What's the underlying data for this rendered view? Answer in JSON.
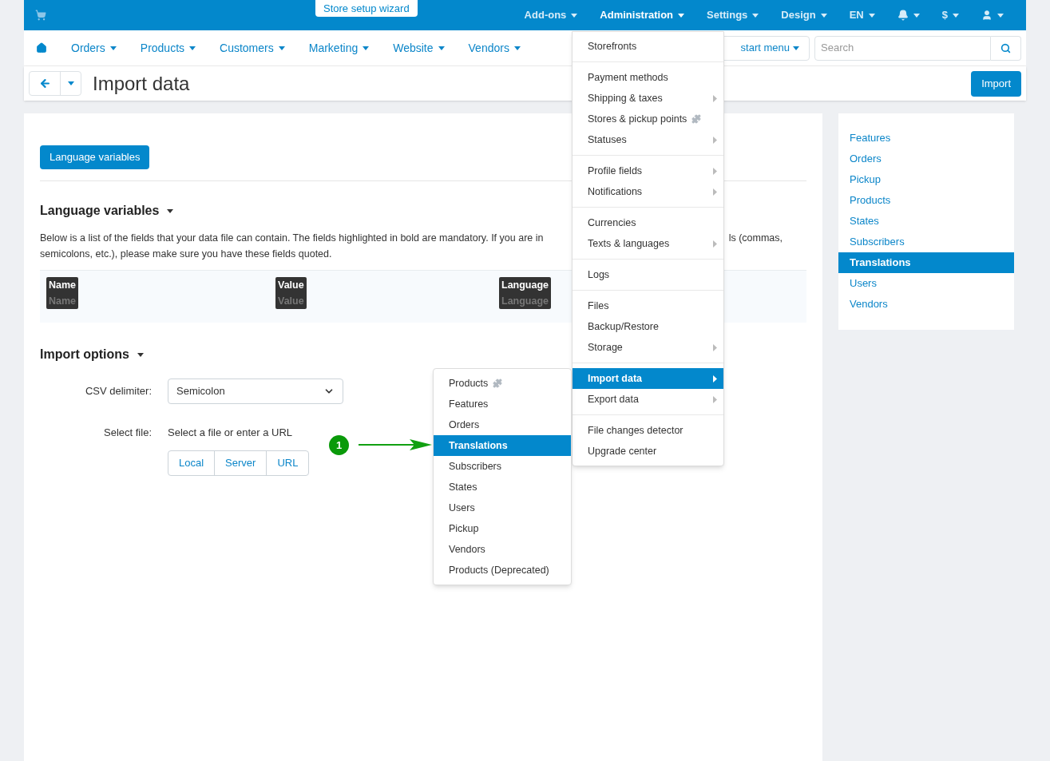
{
  "top_bar": {
    "wizard": "Store setup wizard",
    "items": [
      {
        "kind": "text",
        "label": "Add-ons",
        "selected": false
      },
      {
        "kind": "text",
        "label": "Administration",
        "selected": true
      },
      {
        "kind": "text",
        "label": "Settings",
        "selected": false
      },
      {
        "kind": "text",
        "label": "Design",
        "selected": false
      },
      {
        "kind": "text",
        "label": "EN",
        "selected": false
      },
      {
        "kind": "bell",
        "selected": false
      },
      {
        "kind": "text",
        "label": "$",
        "selected": false
      },
      {
        "kind": "user",
        "selected": false
      }
    ]
  },
  "main_nav": [
    "Orders",
    "Products",
    "Customers",
    "Marketing",
    "Website",
    "Vendors"
  ],
  "quick_menu": "start menu",
  "search": {
    "placeholder": "Search"
  },
  "page_title": "Import data",
  "import_button": "Import",
  "section_tab": "Language variables",
  "fields_section": {
    "title": "Language variables",
    "text_left": "Below is a list of the fields that your data file can contain. The fields highlighted in bold are mandatory. If you are in",
    "text_right": "ls (commas,",
    "text_line2": "semicolons, etc.), please make sure you have these fields quoted.",
    "fields": [
      {
        "label": "Name",
        "sample": "Name",
        "mandatory": true
      },
      {
        "label": "Value",
        "sample": "Value",
        "mandatory": true
      },
      {
        "label": "Language",
        "sample": "Language",
        "mandatory": true
      }
    ]
  },
  "import_options": {
    "title": "Import options",
    "csv_label": "CSV delimiter:",
    "csv_value": "Semicolon",
    "file_label": "Select file:",
    "file_hint": "Select a file or enter a URL",
    "file_buttons": [
      "Local",
      "Server",
      "URL"
    ]
  },
  "annotation": {
    "number": "1"
  },
  "sidebar": [
    {
      "label": "Features",
      "selected": false
    },
    {
      "label": "Orders",
      "selected": false
    },
    {
      "label": "Pickup",
      "selected": false
    },
    {
      "label": "Products",
      "selected": false
    },
    {
      "label": "States",
      "selected": false
    },
    {
      "label": "Subscribers",
      "selected": false
    },
    {
      "label": "Translations",
      "selected": true
    },
    {
      "label": "Users",
      "selected": false
    },
    {
      "label": "Vendors",
      "selected": false
    }
  ],
  "admin_menu": [
    [
      {
        "label": "Storefronts",
        "kind": "link",
        "selected": false
      }
    ],
    [
      {
        "label": "Payment methods",
        "kind": "link",
        "selected": false
      },
      {
        "label": "Shipping & taxes",
        "kind": "submenu",
        "selected": false
      },
      {
        "label": "Stores & pickup points",
        "kind": "addon",
        "selected": false
      },
      {
        "label": "Statuses",
        "kind": "submenu",
        "selected": false
      }
    ],
    [
      {
        "label": "Profile fields",
        "kind": "submenu",
        "selected": false
      },
      {
        "label": "Notifications",
        "kind": "submenu",
        "selected": false
      }
    ],
    [
      {
        "label": "Currencies",
        "kind": "link",
        "selected": false
      },
      {
        "label": "Texts & languages",
        "kind": "submenu",
        "selected": false
      }
    ],
    [
      {
        "label": "Logs",
        "kind": "link",
        "selected": false
      }
    ],
    [
      {
        "label": "Files",
        "kind": "link",
        "selected": false
      },
      {
        "label": "Backup/Restore",
        "kind": "link",
        "selected": false
      },
      {
        "label": "Storage",
        "kind": "submenu",
        "selected": false
      }
    ],
    [
      {
        "label": "Import data",
        "kind": "submenu",
        "selected": true
      },
      {
        "label": "Export data",
        "kind": "submenu",
        "selected": false
      }
    ],
    [
      {
        "label": "File changes detector",
        "kind": "link",
        "selected": false
      },
      {
        "label": "Upgrade center",
        "kind": "link",
        "selected": false
      }
    ]
  ],
  "import_submenu": [
    {
      "label": "Products",
      "kind": "addon",
      "selected": false
    },
    {
      "label": "Features",
      "kind": "link",
      "selected": false
    },
    {
      "label": "Orders",
      "kind": "link",
      "selected": false
    },
    {
      "label": "Translations",
      "kind": "link",
      "selected": true
    },
    {
      "label": "Subscribers",
      "kind": "link",
      "selected": false
    },
    {
      "label": "States",
      "kind": "link",
      "selected": false
    },
    {
      "label": "Users",
      "kind": "link",
      "selected": false
    },
    {
      "label": "Pickup",
      "kind": "link",
      "selected": false
    },
    {
      "label": "Vendors",
      "kind": "link",
      "selected": false
    },
    {
      "label": "Products (Deprecated)",
      "kind": "link",
      "selected": false
    }
  ]
}
